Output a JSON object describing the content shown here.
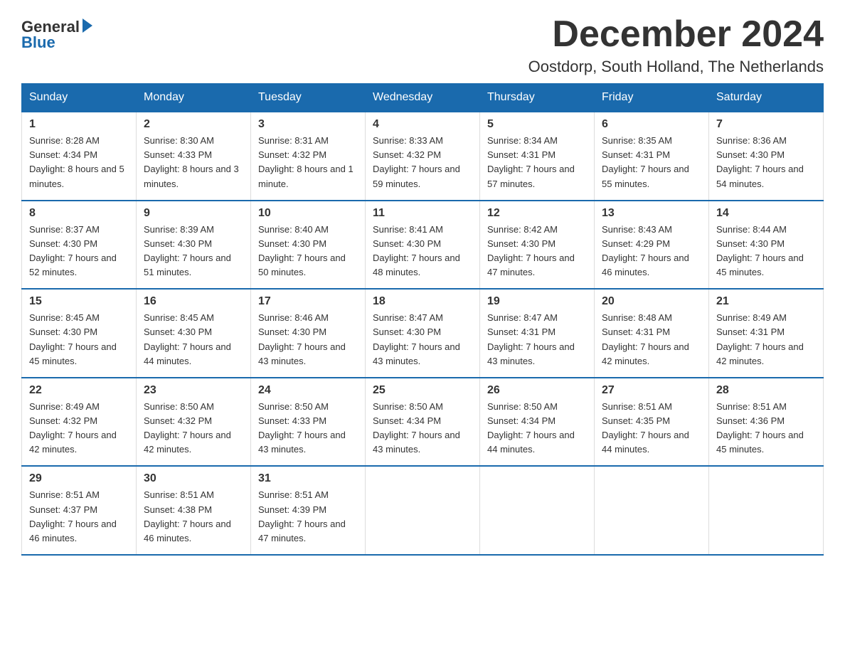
{
  "logo": {
    "general": "General",
    "blue": "Blue"
  },
  "title": "December 2024",
  "location": "Oostdorp, South Holland, The Netherlands",
  "days_of_week": [
    "Sunday",
    "Monday",
    "Tuesday",
    "Wednesday",
    "Thursday",
    "Friday",
    "Saturday"
  ],
  "weeks": [
    [
      {
        "day": "1",
        "sunrise": "8:28 AM",
        "sunset": "4:34 PM",
        "daylight": "8 hours and 5 minutes."
      },
      {
        "day": "2",
        "sunrise": "8:30 AM",
        "sunset": "4:33 PM",
        "daylight": "8 hours and 3 minutes."
      },
      {
        "day": "3",
        "sunrise": "8:31 AM",
        "sunset": "4:32 PM",
        "daylight": "8 hours and 1 minute."
      },
      {
        "day": "4",
        "sunrise": "8:33 AM",
        "sunset": "4:32 PM",
        "daylight": "7 hours and 59 minutes."
      },
      {
        "day": "5",
        "sunrise": "8:34 AM",
        "sunset": "4:31 PM",
        "daylight": "7 hours and 57 minutes."
      },
      {
        "day": "6",
        "sunrise": "8:35 AM",
        "sunset": "4:31 PM",
        "daylight": "7 hours and 55 minutes."
      },
      {
        "day": "7",
        "sunrise": "8:36 AM",
        "sunset": "4:30 PM",
        "daylight": "7 hours and 54 minutes."
      }
    ],
    [
      {
        "day": "8",
        "sunrise": "8:37 AM",
        "sunset": "4:30 PM",
        "daylight": "7 hours and 52 minutes."
      },
      {
        "day": "9",
        "sunrise": "8:39 AM",
        "sunset": "4:30 PM",
        "daylight": "7 hours and 51 minutes."
      },
      {
        "day": "10",
        "sunrise": "8:40 AM",
        "sunset": "4:30 PM",
        "daylight": "7 hours and 50 minutes."
      },
      {
        "day": "11",
        "sunrise": "8:41 AM",
        "sunset": "4:30 PM",
        "daylight": "7 hours and 48 minutes."
      },
      {
        "day": "12",
        "sunrise": "8:42 AM",
        "sunset": "4:30 PM",
        "daylight": "7 hours and 47 minutes."
      },
      {
        "day": "13",
        "sunrise": "8:43 AM",
        "sunset": "4:29 PM",
        "daylight": "7 hours and 46 minutes."
      },
      {
        "day": "14",
        "sunrise": "8:44 AM",
        "sunset": "4:30 PM",
        "daylight": "7 hours and 45 minutes."
      }
    ],
    [
      {
        "day": "15",
        "sunrise": "8:45 AM",
        "sunset": "4:30 PM",
        "daylight": "7 hours and 45 minutes."
      },
      {
        "day": "16",
        "sunrise": "8:45 AM",
        "sunset": "4:30 PM",
        "daylight": "7 hours and 44 minutes."
      },
      {
        "day": "17",
        "sunrise": "8:46 AM",
        "sunset": "4:30 PM",
        "daylight": "7 hours and 43 minutes."
      },
      {
        "day": "18",
        "sunrise": "8:47 AM",
        "sunset": "4:30 PM",
        "daylight": "7 hours and 43 minutes."
      },
      {
        "day": "19",
        "sunrise": "8:47 AM",
        "sunset": "4:31 PM",
        "daylight": "7 hours and 43 minutes."
      },
      {
        "day": "20",
        "sunrise": "8:48 AM",
        "sunset": "4:31 PM",
        "daylight": "7 hours and 42 minutes."
      },
      {
        "day": "21",
        "sunrise": "8:49 AM",
        "sunset": "4:31 PM",
        "daylight": "7 hours and 42 minutes."
      }
    ],
    [
      {
        "day": "22",
        "sunrise": "8:49 AM",
        "sunset": "4:32 PM",
        "daylight": "7 hours and 42 minutes."
      },
      {
        "day": "23",
        "sunrise": "8:50 AM",
        "sunset": "4:32 PM",
        "daylight": "7 hours and 42 minutes."
      },
      {
        "day": "24",
        "sunrise": "8:50 AM",
        "sunset": "4:33 PM",
        "daylight": "7 hours and 43 minutes."
      },
      {
        "day": "25",
        "sunrise": "8:50 AM",
        "sunset": "4:34 PM",
        "daylight": "7 hours and 43 minutes."
      },
      {
        "day": "26",
        "sunrise": "8:50 AM",
        "sunset": "4:34 PM",
        "daylight": "7 hours and 44 minutes."
      },
      {
        "day": "27",
        "sunrise": "8:51 AM",
        "sunset": "4:35 PM",
        "daylight": "7 hours and 44 minutes."
      },
      {
        "day": "28",
        "sunrise": "8:51 AM",
        "sunset": "4:36 PM",
        "daylight": "7 hours and 45 minutes."
      }
    ],
    [
      {
        "day": "29",
        "sunrise": "8:51 AM",
        "sunset": "4:37 PM",
        "daylight": "7 hours and 46 minutes."
      },
      {
        "day": "30",
        "sunrise": "8:51 AM",
        "sunset": "4:38 PM",
        "daylight": "7 hours and 46 minutes."
      },
      {
        "day": "31",
        "sunrise": "8:51 AM",
        "sunset": "4:39 PM",
        "daylight": "7 hours and 47 minutes."
      },
      null,
      null,
      null,
      null
    ]
  ]
}
